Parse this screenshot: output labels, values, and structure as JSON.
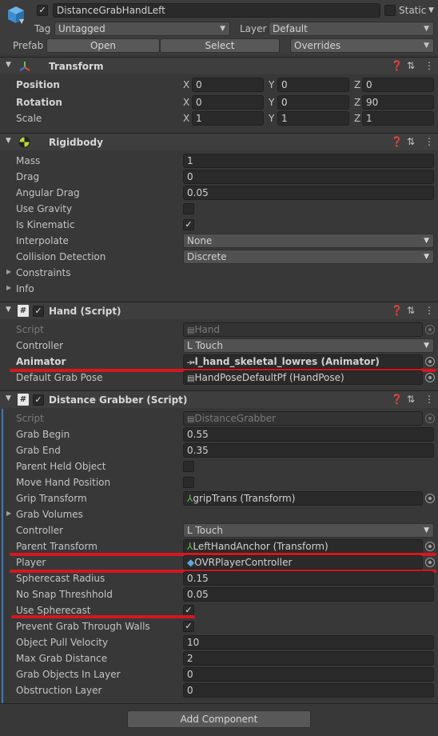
{
  "header": {
    "object_name": "DistanceGrabHandLeft",
    "static_label": "Static",
    "tag_label": "Tag",
    "tag_value": "Untagged",
    "layer_label": "Layer",
    "layer_value": "Default",
    "prefab_label": "Prefab",
    "open_label": "Open",
    "select_label": "Select",
    "overrides_label": "Overrides"
  },
  "transform": {
    "title": "Transform",
    "rows": [
      {
        "label": "Position",
        "x": "0",
        "y": "0",
        "z": "0"
      },
      {
        "label": "Rotation",
        "x": "0",
        "y": "0",
        "z": "90"
      },
      {
        "label": "Scale",
        "x": "1",
        "y": "1",
        "z": "1"
      }
    ]
  },
  "rigidbody": {
    "title": "Rigidbody",
    "mass_label": "Mass",
    "mass": "1",
    "drag_label": "Drag",
    "drag": "0",
    "angular_drag_label": "Angular Drag",
    "angular_drag": "0.05",
    "use_gravity_label": "Use Gravity",
    "is_kinematic_label": "Is Kinematic",
    "interpolate_label": "Interpolate",
    "interpolate": "None",
    "collision_label": "Collision Detection",
    "collision": "Discrete",
    "constraints_label": "Constraints",
    "info_label": "Info"
  },
  "hand": {
    "title": "Hand (Script)",
    "script_label": "Script",
    "script": "Hand",
    "controller_label": "Controller",
    "controller": "L Touch",
    "animator_label": "Animator",
    "animator": "l_hand_skeletal_lowres (Animator)",
    "grab_pose_label": "Default Grab Pose",
    "grab_pose": "HandPoseDefaultPf (HandPose)"
  },
  "grabber": {
    "title": "Distance Grabber (Script)",
    "script_label": "Script",
    "script": "DistanceGrabber",
    "grab_begin_label": "Grab Begin",
    "grab_begin": "0.55",
    "grab_end_label": "Grab End",
    "grab_end": "0.35",
    "parent_held_label": "Parent Held Object",
    "move_hand_label": "Move Hand Position",
    "grip_transform_label": "Grip Transform",
    "grip_transform": "gripTrans (Transform)",
    "grab_volumes_label": "Grab Volumes",
    "controller_label": "Controller",
    "controller": "L Touch",
    "parent_transform_label": "Parent Transform",
    "parent_transform": "LeftHandAnchor (Transform)",
    "player_label": "Player",
    "player": "OVRPlayerController",
    "spherecast_radius_label": "Spherecast Radius",
    "spherecast_radius": "0.15",
    "no_snap_label": "No Snap Threshhold",
    "no_snap": "0.05",
    "use_spherecast_label": "Use Spherecast",
    "prevent_grab_label": "Prevent Grab Through Walls",
    "pull_velocity_label": "Object Pull Velocity",
    "pull_velocity": "10",
    "max_grab_label": "Max Grab Distance",
    "max_grab": "2",
    "grab_layer_label": "Grab Objects In Layer",
    "grab_layer": "0",
    "obstruction_label": "Obstruction Layer",
    "obstruction": "0"
  },
  "footer": {
    "add_component": "Add Component"
  },
  "colors": {
    "highlight": "#d6161f",
    "panel": "#383838",
    "field": "#2a2a2a"
  }
}
